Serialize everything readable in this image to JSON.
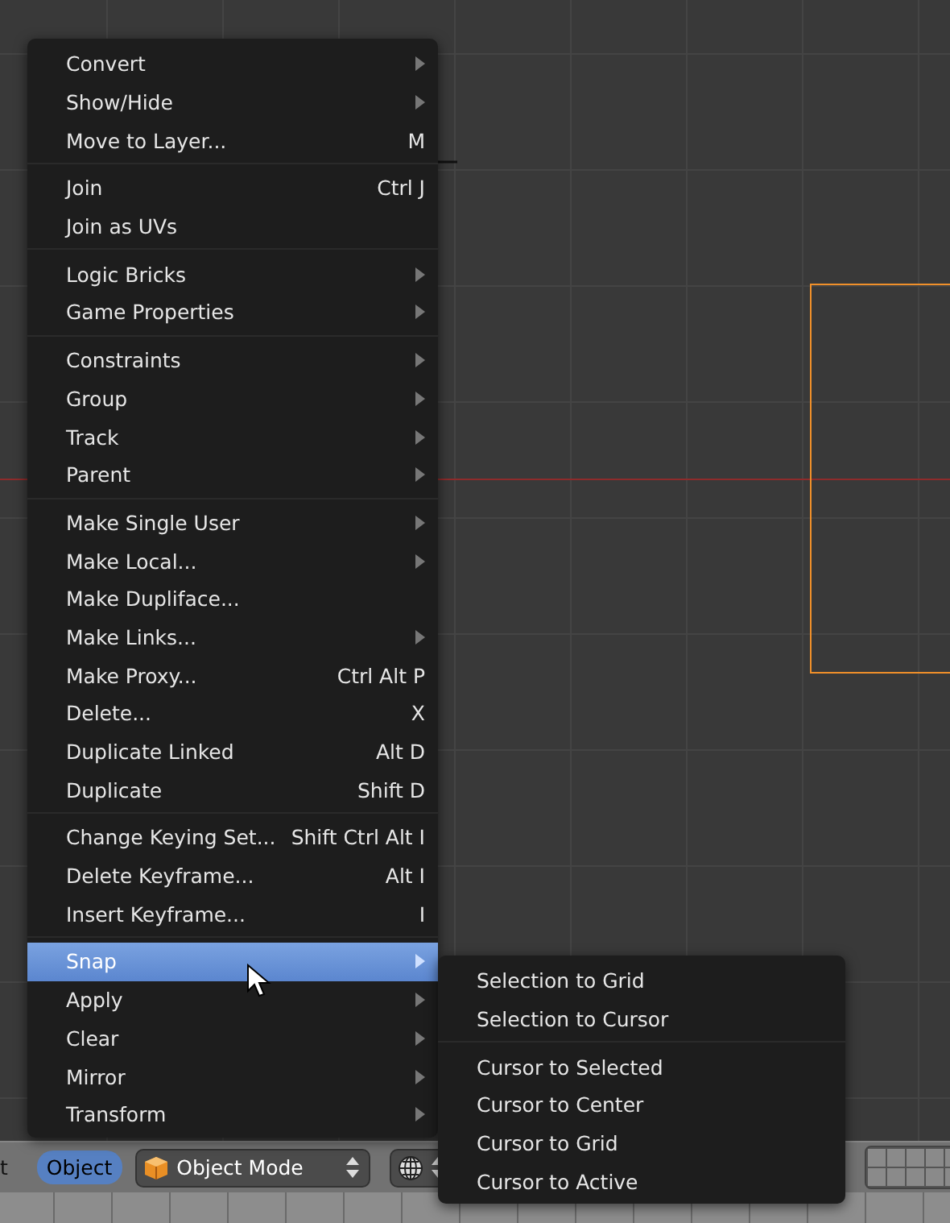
{
  "menu": {
    "sections": [
      {
        "items": [
          {
            "label": "Convert",
            "has_submenu": true,
            "selected": false
          },
          {
            "label": "Show/Hide",
            "has_submenu": true,
            "selected": false
          },
          {
            "label": "Move to Layer...",
            "shortcut": "M",
            "has_submenu": false,
            "selected": false
          }
        ]
      },
      {
        "items": [
          {
            "label": "Join",
            "shortcut": "Ctrl J",
            "has_submenu": false,
            "selected": false
          },
          {
            "label": "Join as UVs",
            "has_submenu": false,
            "selected": false
          }
        ]
      },
      {
        "items": [
          {
            "label": "Logic Bricks",
            "has_submenu": true,
            "selected": false
          },
          {
            "label": "Game Properties",
            "has_submenu": true,
            "selected": false
          }
        ]
      },
      {
        "items": [
          {
            "label": "Constraints",
            "has_submenu": true,
            "selected": false
          },
          {
            "label": "Group",
            "has_submenu": true,
            "selected": false
          },
          {
            "label": "Track",
            "has_submenu": true,
            "selected": false
          },
          {
            "label": "Parent",
            "has_submenu": true,
            "selected": false
          }
        ]
      },
      {
        "items": [
          {
            "label": "Make Single User",
            "has_submenu": true,
            "selected": false
          },
          {
            "label": "Make Local...",
            "has_submenu": true,
            "selected": false
          },
          {
            "label": "Make Dupliface...",
            "has_submenu": false,
            "selected": false
          },
          {
            "label": "Make Links...",
            "has_submenu": true,
            "selected": false
          },
          {
            "label": "Make Proxy...",
            "shortcut": "Ctrl Alt P",
            "has_submenu": false,
            "selected": false
          },
          {
            "label": "Delete...",
            "shortcut": "X",
            "has_submenu": false,
            "selected": false
          },
          {
            "label": "Duplicate Linked",
            "shortcut": "Alt D",
            "has_submenu": false,
            "selected": false
          },
          {
            "label": "Duplicate",
            "shortcut": "Shift D",
            "has_submenu": false,
            "selected": false
          }
        ]
      },
      {
        "items": [
          {
            "label": "Change Keying Set...",
            "shortcut": "Shift Ctrl Alt I",
            "has_submenu": false,
            "selected": false
          },
          {
            "label": "Delete Keyframe...",
            "shortcut": "Alt I",
            "has_submenu": false,
            "selected": false
          },
          {
            "label": "Insert Keyframe...",
            "shortcut": "I",
            "has_submenu": false,
            "selected": false
          }
        ]
      },
      {
        "items": [
          {
            "label": "Snap",
            "has_submenu": true,
            "selected": true
          },
          {
            "label": "Apply",
            "has_submenu": true,
            "selected": false
          },
          {
            "label": "Clear",
            "has_submenu": true,
            "selected": false
          },
          {
            "label": "Mirror",
            "has_submenu": true,
            "selected": false
          },
          {
            "label": "Transform",
            "has_submenu": true,
            "selected": false
          }
        ]
      }
    ]
  },
  "submenu": {
    "sections": [
      {
        "items": [
          {
            "label": "Selection to Grid",
            "selected": false
          },
          {
            "label": "Selection to Cursor",
            "selected": false
          }
        ]
      },
      {
        "items": [
          {
            "label": "Cursor to Selected",
            "selected": false
          },
          {
            "label": "Cursor to Center",
            "selected": false
          },
          {
            "label": "Cursor to Grid",
            "selected": false
          },
          {
            "label": "Cursor to Active",
            "selected": false
          }
        ]
      }
    ]
  },
  "header": {
    "items": [
      {
        "kind": "text",
        "label": "t"
      },
      {
        "kind": "toggle",
        "label": "Object",
        "selected": true
      },
      {
        "kind": "mode-dropdown",
        "label": "Object Mode"
      },
      {
        "kind": "icon-dropdown"
      },
      {
        "kind": "layer-grid"
      }
    ]
  }
}
